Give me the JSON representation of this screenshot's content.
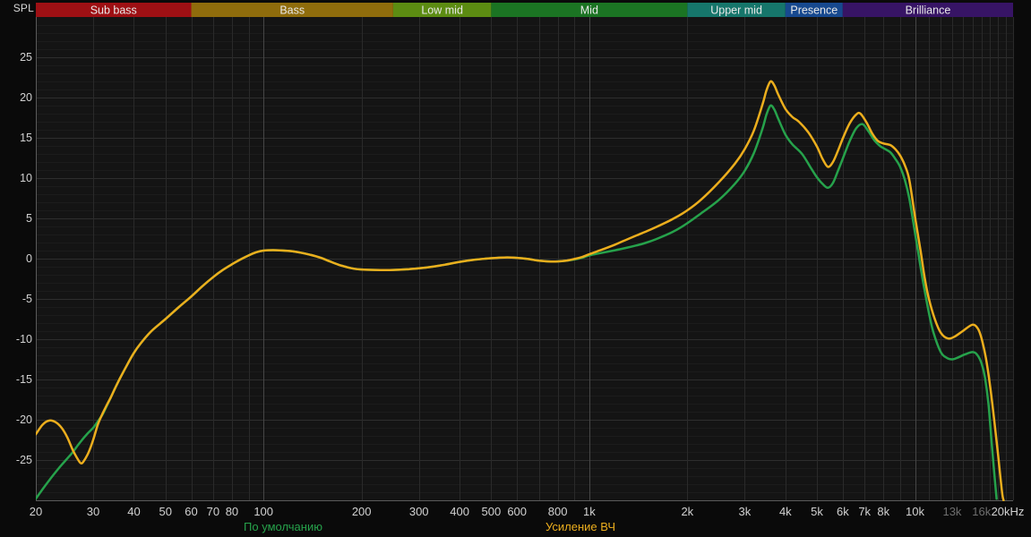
{
  "chart_data": {
    "type": "line",
    "title": "",
    "ylabel": "SPL",
    "legend_position": "bottom",
    "colors": {
      "background": "#0a0a0a",
      "plot_background": "#141414",
      "axis_line": "#5a5a5a",
      "grid_minor_h": "#1c1c1c",
      "grid_major_h": "#2e2e2e",
      "grid_v": "#2a2a2a",
      "grid_decade_v": "#464646",
      "tick_text": "#d2d2d2",
      "dim_tick_text": "#6e6e6e",
      "band_text": "#e9e9e9"
    },
    "x_axis": {
      "scale": "log",
      "unit": "Hz",
      "min": 20,
      "max": 20000,
      "tick_labels": [
        {
          "label": "20",
          "f": 20
        },
        {
          "label": "30",
          "f": 30
        },
        {
          "label": "40",
          "f": 40
        },
        {
          "label": "50",
          "f": 50
        },
        {
          "label": "60",
          "f": 60
        },
        {
          "label": "70",
          "f": 70
        },
        {
          "label": "80",
          "f": 80
        },
        {
          "label": "100",
          "f": 100
        },
        {
          "label": "200",
          "f": 200
        },
        {
          "label": "300",
          "f": 300
        },
        {
          "label": "400",
          "f": 400
        },
        {
          "label": "500",
          "f": 500
        },
        {
          "label": "600",
          "f": 600
        },
        {
          "label": "800",
          "f": 800
        },
        {
          "label": "1k",
          "f": 1000
        },
        {
          "label": "2k",
          "f": 2000
        },
        {
          "label": "3k",
          "f": 3000
        },
        {
          "label": "4k",
          "f": 4000
        },
        {
          "label": "5k",
          "f": 5000
        },
        {
          "label": "6k",
          "f": 6000
        },
        {
          "label": "7k",
          "f": 7000
        },
        {
          "label": "8k",
          "f": 8000
        },
        {
          "label": "10k",
          "f": 10000
        },
        {
          "label": "13k",
          "f": 13000,
          "dim": true
        },
        {
          "label": "16k",
          "f": 16000,
          "dim": true
        },
        {
          "label": "20kHz",
          "f": 20000
        }
      ]
    },
    "y_axis": {
      "unit": "dB",
      "min": -30,
      "max": 30,
      "major_step": 5,
      "minor_step": 1,
      "tick_labels": [
        25,
        20,
        15,
        10,
        5,
        0,
        -5,
        -10,
        -15,
        -20,
        -25
      ]
    },
    "bands": [
      {
        "label": "Sub bass",
        "from": 20,
        "to": 60,
        "color": "#9e1014"
      },
      {
        "label": "Bass",
        "from": 60,
        "to": 250,
        "color": "#8f6c0c"
      },
      {
        "label": "Low mid",
        "from": 250,
        "to": 500,
        "color": "#5c8c12"
      },
      {
        "label": "Mid",
        "from": 500,
        "to": 2000,
        "color": "#1b7423"
      },
      {
        "label": "Upper mid",
        "from": 2000,
        "to": 4000,
        "color": "#16766b"
      },
      {
        "label": "Presence",
        "from": 4000,
        "to": 6000,
        "color": "#17498f"
      },
      {
        "label": "Brilliance",
        "from": 6000,
        "to": 20000,
        "color": "#371465"
      }
    ],
    "series": [
      {
        "name": "По умолчанию",
        "color": "#26a24b",
        "points": [
          [
            20,
            -29.8
          ],
          [
            21,
            -28.6
          ],
          [
            22,
            -27.5
          ],
          [
            23,
            -26.5
          ],
          [
            24,
            -25.6
          ],
          [
            25,
            -24.8
          ],
          [
            26,
            -24.0
          ],
          [
            27,
            -23.1
          ],
          [
            28,
            -22.3
          ],
          [
            29,
            -21.6
          ],
          [
            30,
            -21.0
          ],
          [
            31,
            -20.2
          ],
          [
            32,
            -19.4
          ],
          [
            33,
            -18.3
          ],
          [
            34,
            -17.2
          ],
          [
            35,
            -16.1
          ],
          [
            36,
            -15.1
          ],
          [
            38,
            -13.3
          ],
          [
            40,
            -11.7
          ],
          [
            42,
            -10.5
          ],
          [
            45,
            -9.1
          ],
          [
            48,
            -8.1
          ],
          [
            50,
            -7.5
          ],
          [
            55,
            -6.0
          ],
          [
            60,
            -4.7
          ],
          [
            65,
            -3.4
          ],
          [
            70,
            -2.3
          ],
          [
            75,
            -1.4
          ],
          [
            80,
            -0.7
          ],
          [
            85,
            -0.1
          ],
          [
            90,
            0.4
          ],
          [
            95,
            0.8
          ],
          [
            100,
            1.0
          ],
          [
            110,
            1.05
          ],
          [
            120,
            0.95
          ],
          [
            130,
            0.75
          ],
          [
            140,
            0.45
          ],
          [
            150,
            0.1
          ],
          [
            160,
            -0.35
          ],
          [
            170,
            -0.75
          ],
          [
            180,
            -1.05
          ],
          [
            190,
            -1.25
          ],
          [
            200,
            -1.35
          ],
          [
            220,
            -1.4
          ],
          [
            250,
            -1.4
          ],
          [
            280,
            -1.3
          ],
          [
            300,
            -1.2
          ],
          [
            330,
            -1.0
          ],
          [
            360,
            -0.75
          ],
          [
            400,
            -0.4
          ],
          [
            440,
            -0.15
          ],
          [
            480,
            0.0
          ],
          [
            520,
            0.1
          ],
          [
            560,
            0.15
          ],
          [
            600,
            0.1
          ],
          [
            650,
            -0.05
          ],
          [
            700,
            -0.25
          ],
          [
            750,
            -0.35
          ],
          [
            800,
            -0.35
          ],
          [
            850,
            -0.25
          ],
          [
            900,
            -0.1
          ],
          [
            950,
            0.1
          ],
          [
            1000,
            0.4
          ],
          [
            1100,
            0.75
          ],
          [
            1200,
            1.05
          ],
          [
            1300,
            1.35
          ],
          [
            1400,
            1.65
          ],
          [
            1500,
            2.0
          ],
          [
            1600,
            2.4
          ],
          [
            1800,
            3.3
          ],
          [
            2000,
            4.4
          ],
          [
            2200,
            5.6
          ],
          [
            2500,
            7.3
          ],
          [
            2800,
            9.3
          ],
          [
            3000,
            10.9
          ],
          [
            3200,
            13.1
          ],
          [
            3400,
            16.1
          ],
          [
            3500,
            17.9
          ],
          [
            3600,
            19.0
          ],
          [
            3700,
            18.5
          ],
          [
            3800,
            17.4
          ],
          [
            4000,
            15.4
          ],
          [
            4200,
            14.2
          ],
          [
            4500,
            13.0
          ],
          [
            4800,
            11.2
          ],
          [
            5000,
            10.1
          ],
          [
            5200,
            9.3
          ],
          [
            5400,
            8.8
          ],
          [
            5600,
            9.4
          ],
          [
            5800,
            10.9
          ],
          [
            6000,
            12.4
          ],
          [
            6300,
            14.6
          ],
          [
            6600,
            16.2
          ],
          [
            6900,
            16.7
          ],
          [
            7200,
            15.8
          ],
          [
            7500,
            14.7
          ],
          [
            7800,
            14.0
          ],
          [
            8100,
            13.6
          ],
          [
            8400,
            13.2
          ],
          [
            8700,
            12.4
          ],
          [
            9000,
            11.4
          ],
          [
            9300,
            9.8
          ],
          [
            9600,
            7.5
          ],
          [
            10000,
            3.2
          ],
          [
            10300,
            0.0
          ],
          [
            10600,
            -3.0
          ],
          [
            11000,
            -6.5
          ],
          [
            11400,
            -9.2
          ],
          [
            12000,
            -11.6
          ],
          [
            12500,
            -12.3
          ],
          [
            13000,
            -12.5
          ],
          [
            13500,
            -12.3
          ],
          [
            14200,
            -11.9
          ],
          [
            15000,
            -11.6
          ],
          [
            15500,
            -11.9
          ],
          [
            16000,
            -13.0
          ],
          [
            16400,
            -14.8
          ],
          [
            16800,
            -18.0
          ],
          [
            17200,
            -23.0
          ],
          [
            17500,
            -26.5
          ],
          [
            17800,
            -29.8
          ]
        ]
      },
      {
        "name": "Усиление ВЧ",
        "color": "#ecae1d",
        "points": [
          [
            20,
            -21.8
          ],
          [
            21,
            -20.6
          ],
          [
            22,
            -20.1
          ],
          [
            23,
            -20.3
          ],
          [
            24,
            -21.0
          ],
          [
            25,
            -22.2
          ],
          [
            26,
            -23.8
          ],
          [
            27,
            -25.0
          ],
          [
            27.5,
            -25.4
          ],
          [
            28,
            -25.2
          ],
          [
            29,
            -24.1
          ],
          [
            30,
            -22.5
          ],
          [
            31,
            -20.6
          ],
          [
            32,
            -19.3
          ],
          [
            33,
            -18.2
          ],
          [
            34,
            -17.2
          ],
          [
            35,
            -16.1
          ],
          [
            36,
            -15.1
          ],
          [
            38,
            -13.3
          ],
          [
            40,
            -11.7
          ],
          [
            42,
            -10.5
          ],
          [
            45,
            -9.1
          ],
          [
            48,
            -8.1
          ],
          [
            50,
            -7.5
          ],
          [
            55,
            -6.0
          ],
          [
            60,
            -4.7
          ],
          [
            65,
            -3.4
          ],
          [
            70,
            -2.3
          ],
          [
            75,
            -1.4
          ],
          [
            80,
            -0.7
          ],
          [
            85,
            -0.1
          ],
          [
            90,
            0.4
          ],
          [
            95,
            0.8
          ],
          [
            100,
            1.0
          ],
          [
            110,
            1.05
          ],
          [
            120,
            0.95
          ],
          [
            130,
            0.75
          ],
          [
            140,
            0.45
          ],
          [
            150,
            0.1
          ],
          [
            160,
            -0.35
          ],
          [
            170,
            -0.75
          ],
          [
            180,
            -1.05
          ],
          [
            190,
            -1.25
          ],
          [
            200,
            -1.35
          ],
          [
            220,
            -1.4
          ],
          [
            250,
            -1.4
          ],
          [
            280,
            -1.3
          ],
          [
            300,
            -1.2
          ],
          [
            330,
            -1.0
          ],
          [
            360,
            -0.75
          ],
          [
            400,
            -0.4
          ],
          [
            440,
            -0.15
          ],
          [
            480,
            0.0
          ],
          [
            520,
            0.1
          ],
          [
            560,
            0.15
          ],
          [
            600,
            0.1
          ],
          [
            650,
            -0.05
          ],
          [
            700,
            -0.25
          ],
          [
            750,
            -0.35
          ],
          [
            800,
            -0.35
          ],
          [
            850,
            -0.25
          ],
          [
            900,
            -0.05
          ],
          [
            950,
            0.2
          ],
          [
            1000,
            0.55
          ],
          [
            1100,
            1.15
          ],
          [
            1200,
            1.75
          ],
          [
            1300,
            2.35
          ],
          [
            1400,
            2.9
          ],
          [
            1500,
            3.4
          ],
          [
            1600,
            3.9
          ],
          [
            1800,
            4.9
          ],
          [
            2000,
            6.0
          ],
          [
            2200,
            7.3
          ],
          [
            2500,
            9.5
          ],
          [
            2800,
            11.8
          ],
          [
            3000,
            13.6
          ],
          [
            3200,
            15.9
          ],
          [
            3400,
            19.1
          ],
          [
            3500,
            20.9
          ],
          [
            3600,
            22.0
          ],
          [
            3700,
            21.5
          ],
          [
            3800,
            20.4
          ],
          [
            4000,
            18.6
          ],
          [
            4200,
            17.6
          ],
          [
            4400,
            17.0
          ],
          [
            4700,
            15.7
          ],
          [
            5000,
            13.9
          ],
          [
            5200,
            12.4
          ],
          [
            5400,
            11.4
          ],
          [
            5600,
            12.0
          ],
          [
            5800,
            13.4
          ],
          [
            6000,
            14.9
          ],
          [
            6300,
            16.8
          ],
          [
            6600,
            17.9
          ],
          [
            6800,
            18.0
          ],
          [
            7100,
            16.9
          ],
          [
            7400,
            15.5
          ],
          [
            7700,
            14.6
          ],
          [
            8000,
            14.3
          ],
          [
            8400,
            14.1
          ],
          [
            8700,
            13.6
          ],
          [
            9000,
            12.8
          ],
          [
            9300,
            11.6
          ],
          [
            9600,
            9.8
          ],
          [
            10000,
            5.2
          ],
          [
            10400,
            1.0
          ],
          [
            10700,
            -2.3
          ],
          [
            11000,
            -4.8
          ],
          [
            11500,
            -7.5
          ],
          [
            12000,
            -9.2
          ],
          [
            12600,
            -9.9
          ],
          [
            13200,
            -9.7
          ],
          [
            14000,
            -9.0
          ],
          [
            15000,
            -8.2
          ],
          [
            15600,
            -8.7
          ],
          [
            16000,
            -9.9
          ],
          [
            16500,
            -12.3
          ],
          [
            17000,
            -15.8
          ],
          [
            17500,
            -20.0
          ],
          [
            18000,
            -24.5
          ],
          [
            18500,
            -29.0
          ],
          [
            18700,
            -30.0
          ]
        ]
      }
    ]
  }
}
